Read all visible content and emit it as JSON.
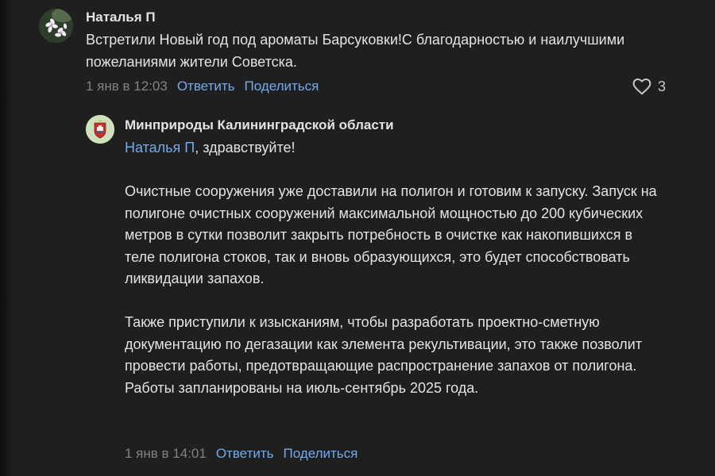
{
  "comment1": {
    "author": "Наталья П",
    "text": "Встретили Новый год под ароматы Барсуковки!С благодарностью и наилучшими пожеланиями жители Советска.",
    "date": "1 янв в 12:03",
    "reply_label": "Ответить",
    "share_label": "Поделиться",
    "likes": "3",
    "like_icon": "heart-outline-icon"
  },
  "reply": {
    "author": "Минприроды Калининградской области",
    "mention": "Наталья П",
    "greeting": ", здравствуйте!",
    "paragraph1": "Очистные сооружения уже доставили на полигон и готовим к запуску. Запуск на полигоне очистных сооружений максимальной мощностью до 200 кубических метров в сутки позволит закрыть потребность в очистке как накопившихся в теле полигона стоков, так и вновь образующихся, это будет способствовать ликвидации запахов.",
    "paragraph2": "Также приступили к изысканиям, чтобы разработать проектно-сметную документацию по дегазации как элемента рекультивации, это также позволит провести работы, предотвращающие распространение запахов от полигона. Работы запланированы на июль-сентябрь 2025 года.",
    "date": "1 янв в 14:01",
    "reply_label": "Ответить",
    "share_label": "Поделиться"
  },
  "colors": {
    "background": "#1f1f20",
    "text": "#e1e3e6",
    "link": "#71aaeb",
    "muted": "#828282"
  }
}
